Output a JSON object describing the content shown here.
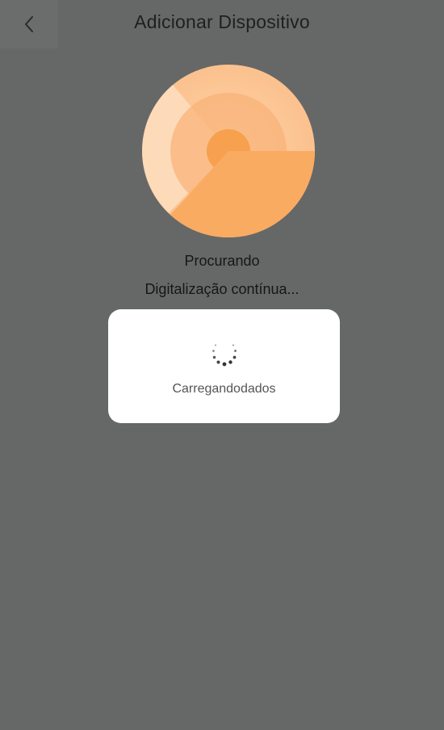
{
  "header": {
    "title": "Adicionar Dispositivo",
    "back_icon": "chevron-left-icon"
  },
  "scanner": {
    "icon": "radar-scan-icon",
    "status": "Procurando",
    "substatus": "Digitalização contínua..."
  },
  "loading_dialog": {
    "icon": "loading-spinner-icon",
    "text": "Carregandodados"
  },
  "colors": {
    "overlay_background": "#666867",
    "radar_outer": "#fbbf86",
    "radar_mid": "#f8ad6c",
    "radar_inner": "#f5a04f",
    "dialog_background": "#ffffff"
  }
}
